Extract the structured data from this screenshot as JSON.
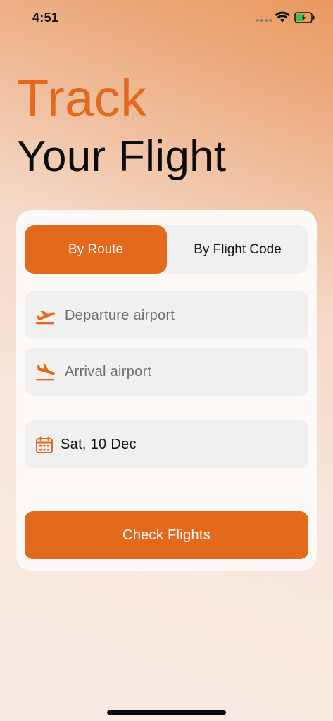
{
  "status_bar": {
    "time": "4:51",
    "signal_icon": "cellular-dots-icon",
    "wifi_icon": "wifi-icon",
    "battery_icon": "battery-charging-icon"
  },
  "header": {
    "title_accent": "Track",
    "title_main": "Your Flight"
  },
  "tabs": [
    {
      "label": "By Route",
      "selected": true
    },
    {
      "label": "By Flight Code",
      "selected": false
    }
  ],
  "form": {
    "departure": {
      "placeholder": "Departure airport",
      "icon": "plane-takeoff-icon"
    },
    "arrival": {
      "placeholder": "Arrival airport",
      "icon": "plane-landing-icon"
    },
    "date": {
      "value": "Sat, 10 Dec",
      "icon": "calendar-icon"
    },
    "submit_label": "Check Flights"
  },
  "colors": {
    "accent": "#e3691d",
    "card_bg": "#fdf9f7",
    "field_bg": "#f0f0f0",
    "placeholder_text": "#6f6f6f"
  }
}
